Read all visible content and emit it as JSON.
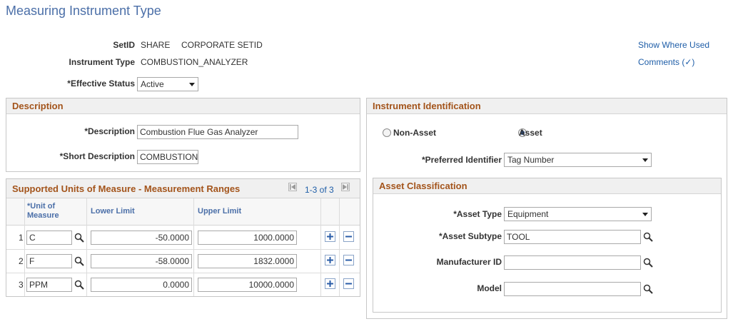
{
  "page": {
    "title": "Measuring Instrument Type",
    "show_where_used": "Show Where Used",
    "comments": "Comments (✓)"
  },
  "header": {
    "setid_label": "SetID",
    "setid_value": "SHARE",
    "setid_desc": "CORPORATE SETID",
    "instrument_type_label": "Instrument Type",
    "instrument_type_value": "COMBUSTION_ANALYZER",
    "effective_status_label": "*Effective Status",
    "effective_status_value": "Active"
  },
  "description": {
    "header": "Description",
    "description_label": "*Description",
    "description_value": "Combustion Flue Gas Analyzer",
    "short_description_label": "*Short Description",
    "short_description_value": "COMBUSTION"
  },
  "uom_grid": {
    "header": "Supported Units of Measure - Measurement Ranges",
    "pager": "1-3 of 3",
    "columns": {
      "uom_line1": "*Unit of",
      "uom_line2": "Measure",
      "lower": "Lower Limit",
      "upper": "Upper Limit"
    },
    "rows": [
      {
        "num": "1",
        "uom": "C",
        "lower": "-50.0000",
        "upper": "1000.0000"
      },
      {
        "num": "2",
        "uom": "F",
        "lower": "-58.0000",
        "upper": "1832.0000"
      },
      {
        "num": "3",
        "uom": "PPM",
        "lower": "0.0000",
        "upper": "10000.0000"
      }
    ]
  },
  "identification": {
    "header": "Instrument Identification",
    "non_asset_label": "Non-Asset",
    "asset_label": "Asset",
    "selected": "Asset",
    "preferred_identifier_label": "*Preferred Identifier",
    "preferred_identifier_value": "Tag Number"
  },
  "asset_classification": {
    "header": "Asset Classification",
    "asset_type_label": "*Asset Type",
    "asset_type_value": "Equipment",
    "asset_subtype_label": "*Asset Subtype",
    "asset_subtype_value": "TOOL",
    "manufacturer_id_label": "Manufacturer ID",
    "manufacturer_id_value": "",
    "model_label": "Model",
    "model_value": ""
  },
  "icons": {
    "lookup": "magnifier-lookup-icon",
    "add_row": "plus-icon",
    "delete_row": "minus-icon",
    "first_page": "first-page-icon",
    "last_page": "last-page-icon"
  },
  "colors": {
    "title": "#4b6fa8",
    "section_header_text": "#a3541b",
    "link": "#1f5ea8"
  }
}
